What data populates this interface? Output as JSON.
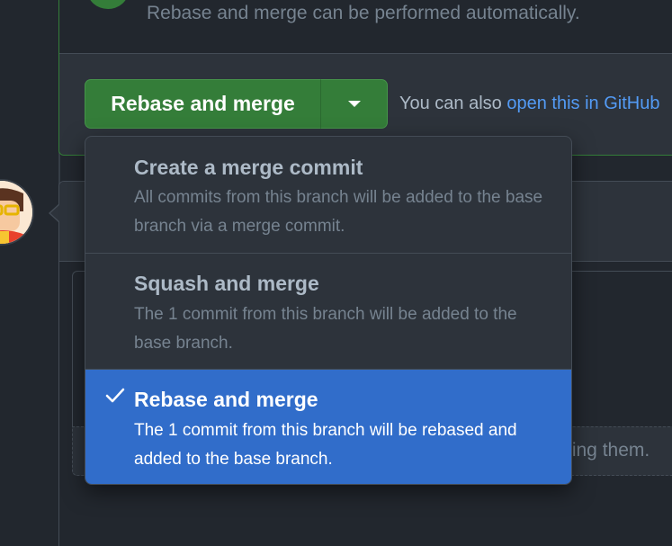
{
  "merge_status": {
    "message": "Rebase and merge can be performed automatically."
  },
  "merge_button": {
    "label": "Rebase and merge",
    "caret_icon": "triangle-down-icon"
  },
  "merge_hint": {
    "prefix": "You can also ",
    "link_text": "open this in GitHub"
  },
  "merge_menu": {
    "items": [
      {
        "title": "Create a merge commit",
        "description": "All commits from this branch will be added to the base branch via a merge commit.",
        "selected": false
      },
      {
        "title": "Squash and merge",
        "description": "The 1 commit from this branch will be added to the base branch.",
        "selected": false
      },
      {
        "title": "Rebase and merge",
        "description": "The 1 commit from this branch will be rebased and added to the base branch.",
        "selected": true,
        "icon": "check-icon"
      }
    ]
  },
  "comment_box": {
    "footer_hint": "ting them."
  },
  "colors": {
    "background": "#22272e",
    "merge_green": "#347d39",
    "selected_blue": "#316dca",
    "link_blue": "#539bf5"
  }
}
